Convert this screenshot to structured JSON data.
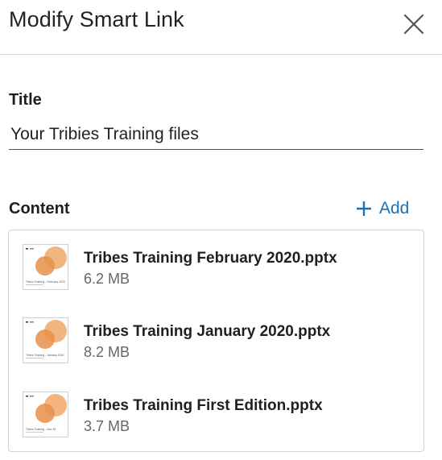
{
  "header": {
    "title": "Modify Smart Link"
  },
  "title_field": {
    "label": "Title",
    "value": "Your Tribies Training files"
  },
  "content": {
    "label": "Content",
    "add_label": "Add",
    "files": [
      {
        "name": "Tribes Training February 2020.pptx",
        "size": "6.2 MB",
        "thumb_caption": "Tribes Training - February 2020"
      },
      {
        "name": "Tribes Training January 2020.pptx",
        "size": "8.2 MB",
        "thumb_caption": "Tribes Training - January 2020"
      },
      {
        "name": "Tribes Training First Edition.pptx",
        "size": "3.7 MB",
        "thumb_caption": "Tribes Training - Nov 19"
      }
    ]
  },
  "colors": {
    "accent": "#1f6fb5",
    "thumb_orange": "#f0a868",
    "thumb_orange_dark": "#e8914a"
  }
}
